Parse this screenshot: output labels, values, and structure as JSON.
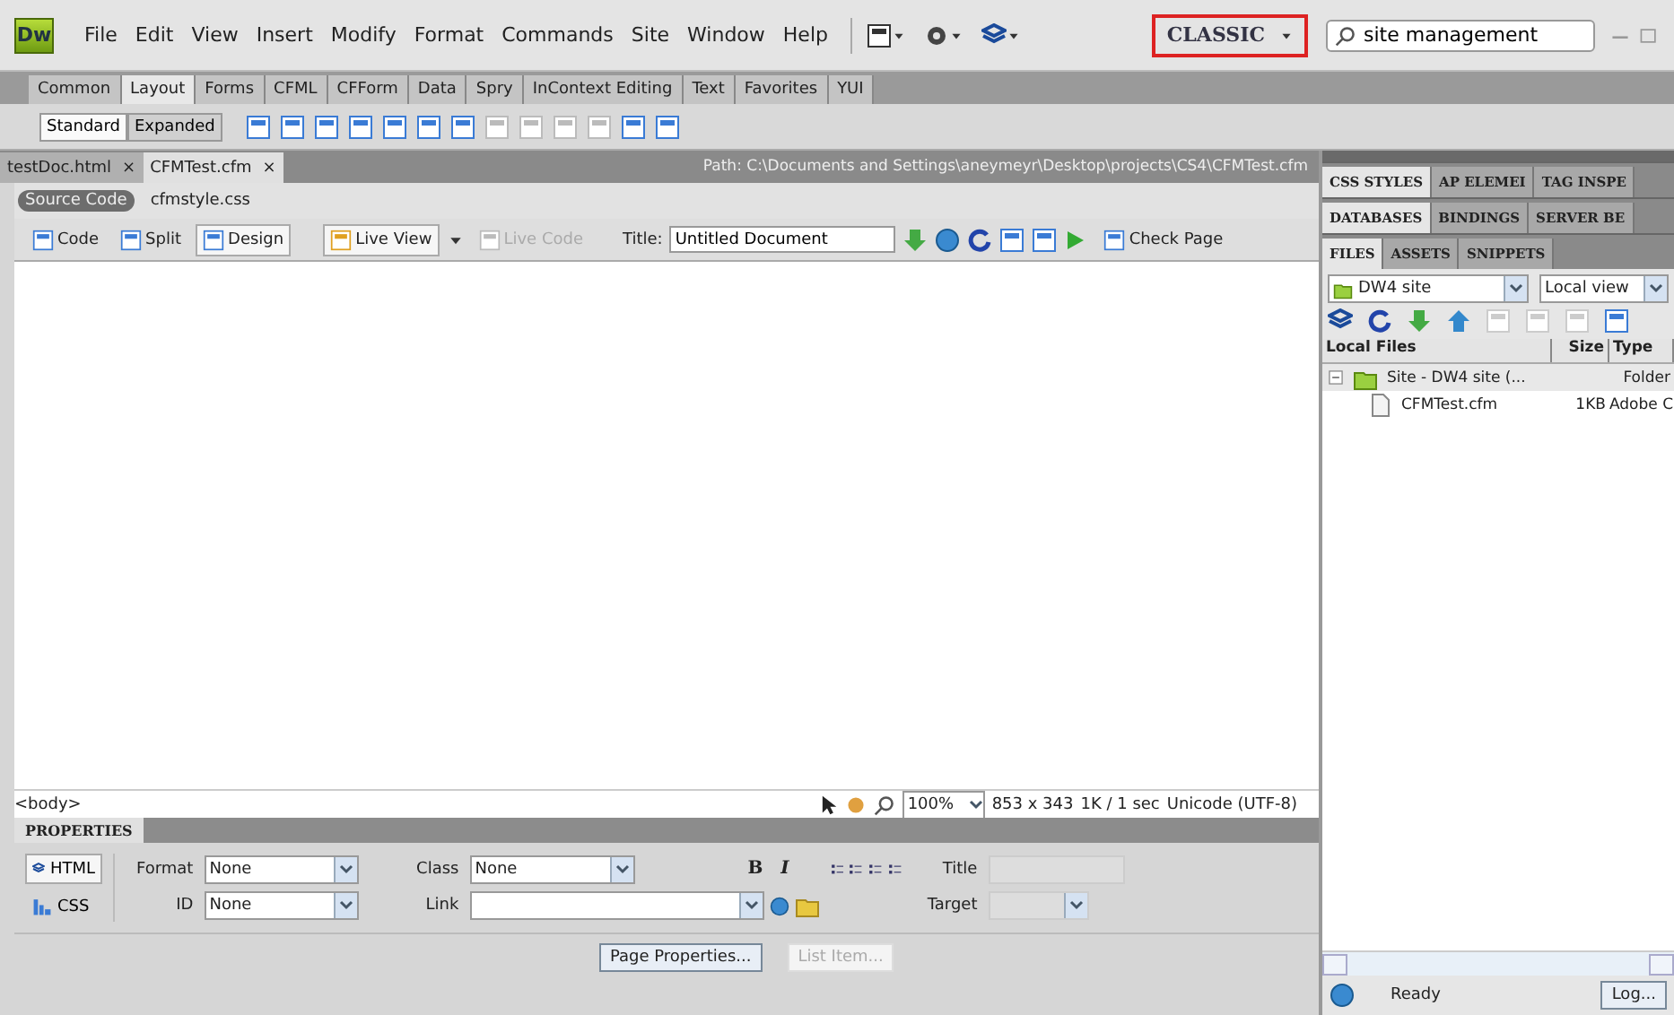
{
  "menu_bar": {
    "logo": "Dw",
    "menus": [
      "File",
      "Edit",
      "View",
      "Insert",
      "Modify",
      "Format",
      "Commands",
      "Site",
      "Window",
      "Help"
    ],
    "workspace": "CLASSIC",
    "search": {
      "value": "site management"
    }
  },
  "insert_tabs": [
    {
      "label": "Common",
      "selected": false
    },
    {
      "label": "Layout",
      "selected": true
    },
    {
      "label": "Forms",
      "selected": false
    },
    {
      "label": "CFML",
      "selected": false
    },
    {
      "label": "CFForm",
      "selected": false
    },
    {
      "label": "Data",
      "selected": false
    },
    {
      "label": "Spry",
      "selected": false
    },
    {
      "label": "InContext Editing",
      "selected": false
    },
    {
      "label": "Text",
      "selected": false
    },
    {
      "label": "Favorites",
      "selected": false
    },
    {
      "label": "YUI",
      "selected": false
    }
  ],
  "insert_modes": [
    {
      "label": "Standard",
      "selected": true
    },
    {
      "label": "Expanded",
      "selected": false
    }
  ],
  "document_tabs": [
    {
      "label": "testDoc.html",
      "close": "×",
      "selected": false
    },
    {
      "label": "CFMTest.cfm",
      "close": "×",
      "selected": true
    }
  ],
  "path": "Path:  C:\\Documents and Settings\\aneymeyr\\Desktop\\projects\\CS4\\CFMTest.cfm",
  "related_files": [
    {
      "label": "Source Code",
      "selected": true
    },
    {
      "label": "cfmstyle.css",
      "selected": false
    }
  ],
  "document_toolbar": {
    "views": [
      {
        "label": "Code",
        "selected": false
      },
      {
        "label": "Split",
        "selected": false
      },
      {
        "label": "Design",
        "selected": true
      }
    ],
    "live_view": "Live View",
    "live_code": {
      "label": "Live Code",
      "disabled": true
    },
    "title_label": "Title:",
    "title_value": "Untitled Document",
    "check_page": "Check Page"
  },
  "status_bar": {
    "tag": "<body>",
    "zoom": "100%",
    "size": "853 x 343",
    "download": "1K / 1 sec",
    "encoding": "Unicode (UTF-8)"
  },
  "properties": {
    "title": "PROPERTIES",
    "modes": [
      {
        "label": "HTML",
        "selected": true
      },
      {
        "label": "CSS",
        "selected": false
      }
    ],
    "format": {
      "label": "Format",
      "value": "None"
    },
    "id": {
      "label": "ID",
      "value": "None"
    },
    "class": {
      "label": "Class",
      "value": "None"
    },
    "link": {
      "label": "Link"
    },
    "bold": "B",
    "italic": "I",
    "title_field": {
      "label": "Title",
      "disabled": true
    },
    "target": {
      "label": "Target",
      "disabled": true
    },
    "buttons": [
      {
        "label": "Page Properties...",
        "disabled": false
      },
      {
        "label": "List Item...",
        "disabled": true
      }
    ]
  },
  "panels": {
    "groups": [
      [
        {
          "label": "CSS STYLES",
          "selected": true
        },
        {
          "label": "AP ELEMEI",
          "selected": false
        },
        {
          "label": "TAG INSPE",
          "selected": false
        }
      ],
      [
        {
          "label": "DATABASES",
          "selected": true
        },
        {
          "label": "BINDINGS",
          "selected": false
        },
        {
          "label": "SERVER BE",
          "selected": false
        }
      ],
      [
        {
          "label": "FILES",
          "selected": true
        },
        {
          "label": "ASSETS",
          "selected": false
        },
        {
          "label": "SNIPPETS",
          "selected": false
        }
      ]
    ],
    "site": "DW4 site",
    "view": "Local view",
    "columns": [
      "Local Files",
      "Size",
      "Type"
    ],
    "files": [
      {
        "name": "Site - DW4 site (...",
        "type": "Folder",
        "kind": "folder",
        "expanded": true,
        "children": [
          {
            "name": "CFMTest.cfm",
            "size": "1KB",
            "type": "Adobe C",
            "kind": "file"
          }
        ]
      }
    ],
    "status": "Ready",
    "log_button": "Log..."
  }
}
